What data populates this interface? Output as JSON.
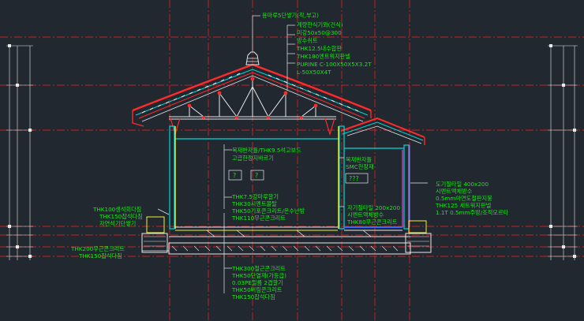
{
  "colors": {
    "background": "#212830",
    "gridRed": "#ff2020",
    "annotation": "#19e619",
    "wall": "#00d8d8",
    "roof": "#ff2a2a",
    "truss": "#e8e8e8",
    "yellow": "#f2f22a",
    "magenta": "#e040e0",
    "blue": "#3a6bff",
    "white": "#ffffff"
  },
  "roofAnnotations": [
    "용마루5단쌓기(착,부고)",
    "계량한식기와(건식)",
    "미강50x50@300",
    "방수쉬트",
    "THK12.5내수합판",
    "THK180엔트워지판넬",
    "PURINE C-100X50X5X3.2T",
    "L-50X50X4T"
  ],
  "midAnnotations": [
    "목재반자틀/THK9.5석고보드",
    "고급한정지바르기"
  ],
  "rightAnnotations": [
    "목재반자틀",
    "SMC천장재"
  ],
  "roomLabels": [
    "?",
    "?",
    "???"
  ],
  "eaveAnnotations": [
    "도기질타일 400x200",
    "시멘트액체방수",
    "0.5mm아연도철판지붕",
    "THK125 세트워지판넬",
    "1.1T 0.5mm주방/조적모르타"
  ],
  "floorAnnotations": [
    "THK7.5강마루깔기",
    "THK30시멘트몰탈",
    "THK50기포콘크리트/온수난방",
    "THK110무근콘크리트"
  ],
  "tileAnnotations": [
    "자기질타일 200x200",
    "시멘트액체방수",
    "THK80무근콘크리트"
  ],
  "leftAnnotations": [
    "THK100생석회다짐",
    "THK150잡석다짐",
    "자연석기단쌓기"
  ],
  "baseLeftAnnotations": [
    "THK200무근콘크리트",
    "THK150잡석다짐"
  ],
  "bottomAnnotations": [
    "THK300철근콘크리트",
    "THK50단열재(가등급)",
    "0.03PE필름 2겹깔기",
    "THK50버림콘크리트",
    "THK150잡석다짐"
  ]
}
